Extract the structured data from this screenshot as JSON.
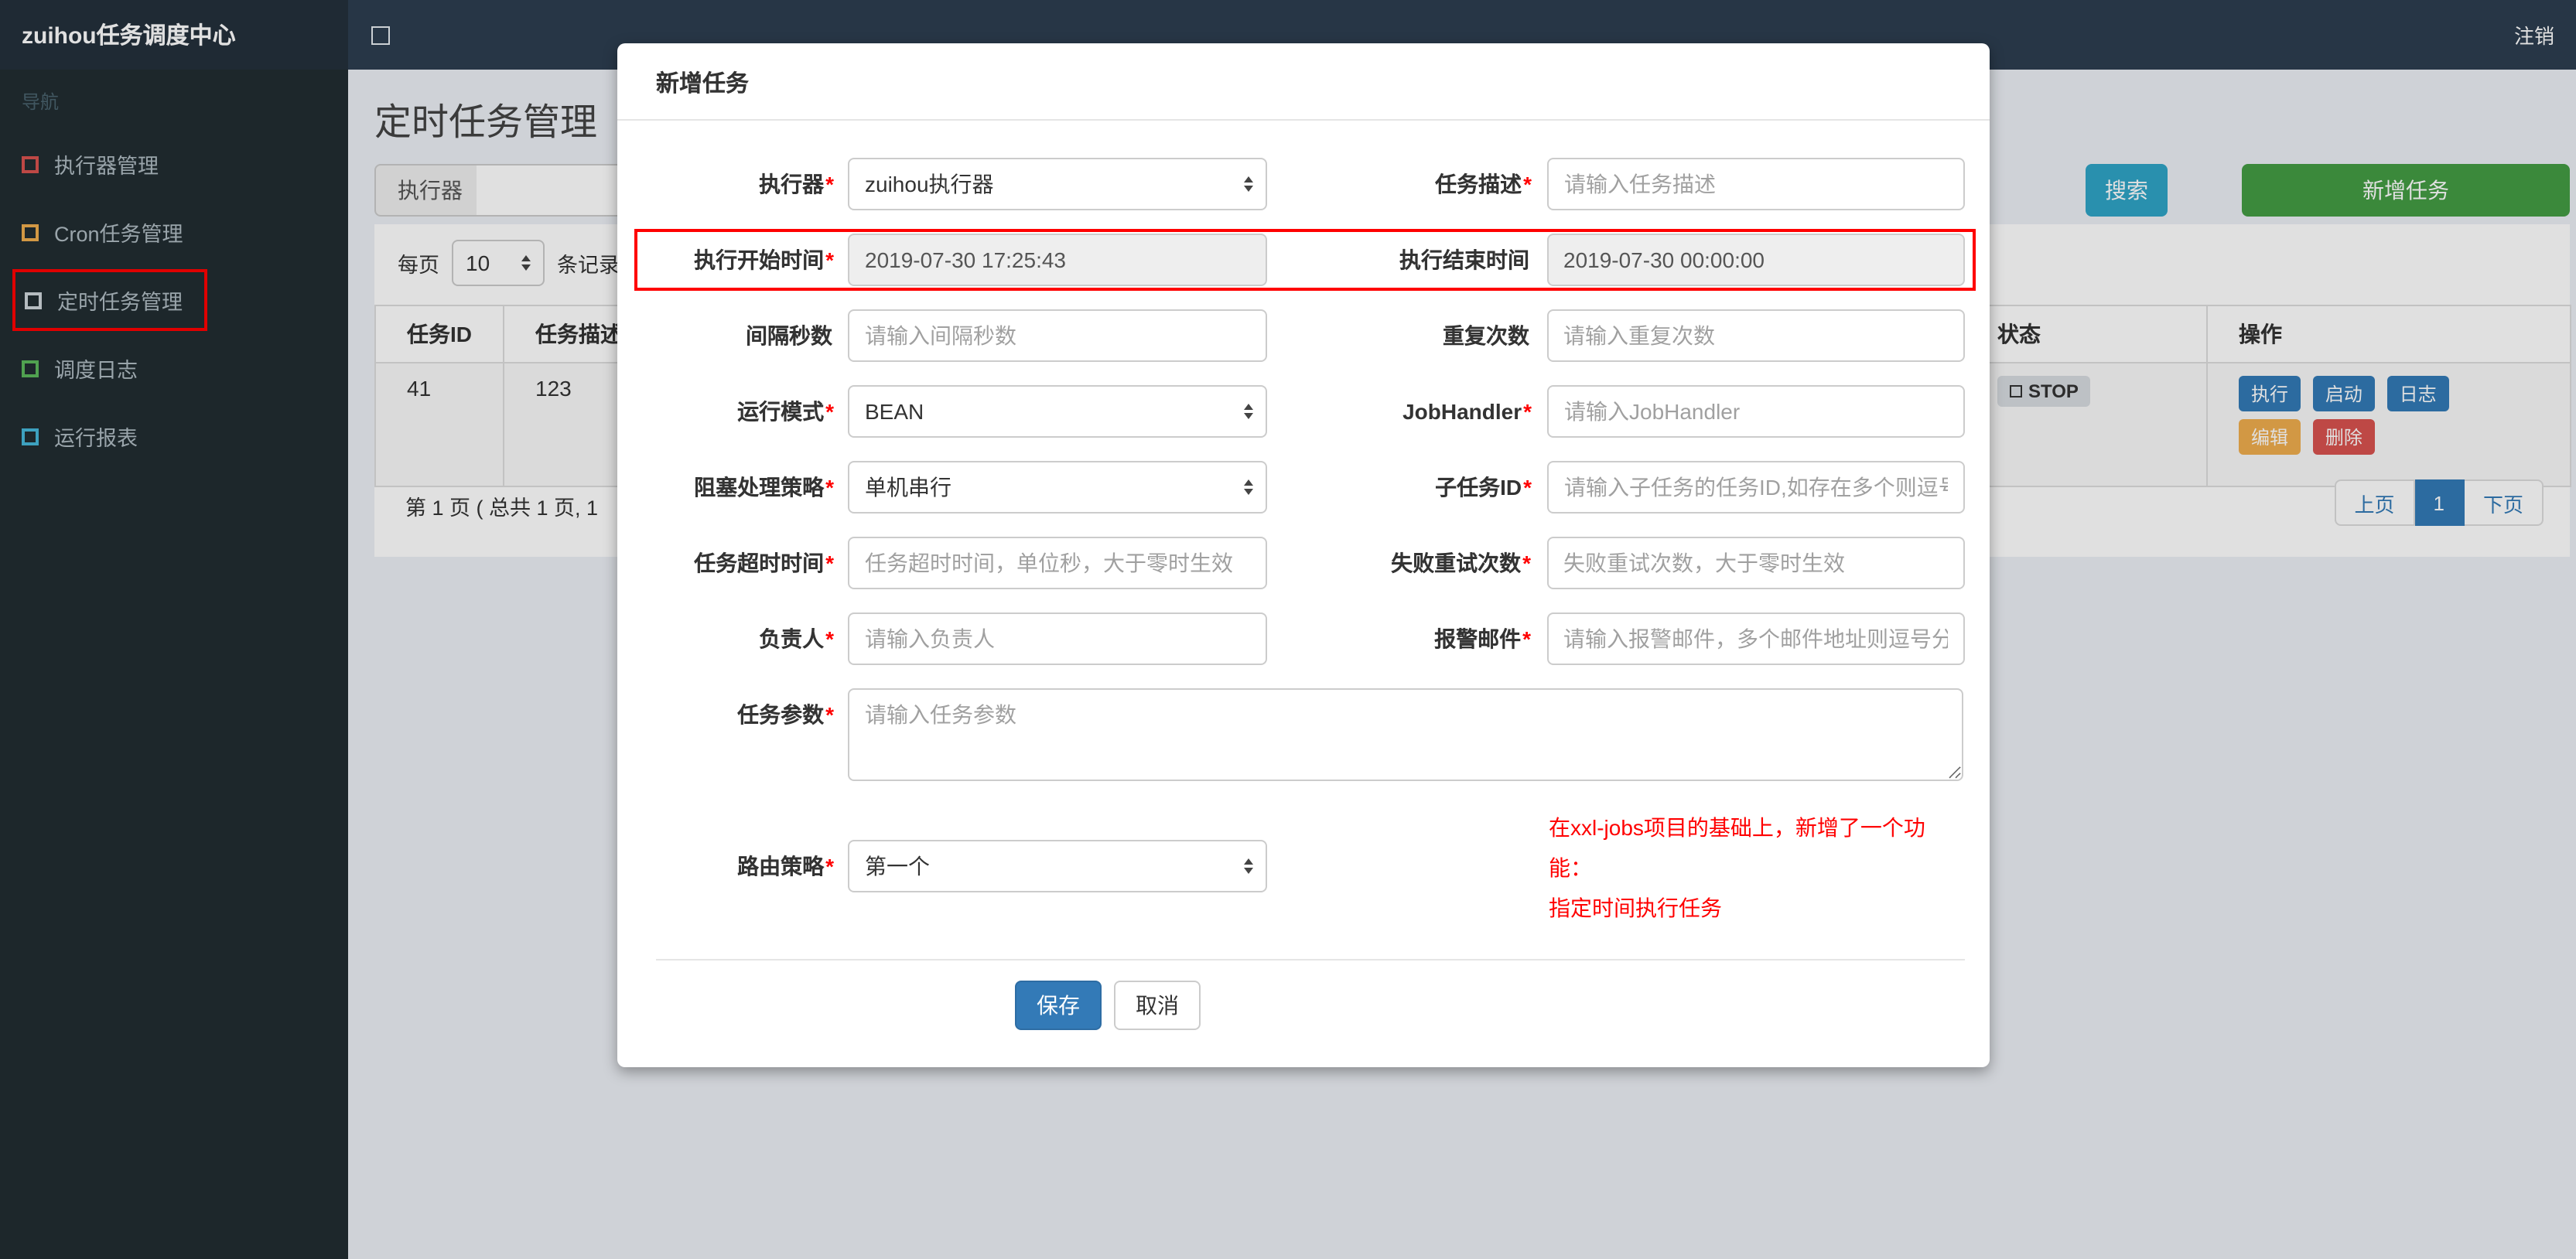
{
  "topbar": {
    "brand": "zuihou任务调度中心",
    "logout": "注销"
  },
  "sidebar": {
    "nav_header": "导航",
    "items": [
      {
        "label": "执行器管理",
        "icon_color": "#d9534f"
      },
      {
        "label": "Cron任务管理",
        "icon_color": "#f0ad4e"
      },
      {
        "label": "定时任务管理",
        "icon_color": "#cfd6db",
        "annotated": true
      },
      {
        "label": "调度日志",
        "icon_color": "#5cb85c"
      },
      {
        "label": "运行报表",
        "icon_color": "#46b8da"
      }
    ]
  },
  "page": {
    "title": "定时任务管理",
    "filter": {
      "executor_addon": "执行器",
      "search_label": "搜索",
      "add_label": "新增任务"
    },
    "page_size": {
      "prefix": "每页",
      "value": "10",
      "suffix": "条记录"
    },
    "table": {
      "headers": [
        "任务ID",
        "任务描述",
        "状态",
        "操作"
      ],
      "row": {
        "id": "41",
        "desc": "123",
        "status": "STOP",
        "actions": {
          "run": "执行",
          "start": "启动",
          "log": "日志",
          "edit": "编辑",
          "delete": "删除"
        }
      }
    },
    "pagination": {
      "summary": "第 1 页 ( 总共 1 页, 1",
      "prev": "上页",
      "current": "1",
      "next": "下页"
    }
  },
  "modal": {
    "title": "新增任务",
    "rows": [
      {
        "l_label": "执行器",
        "l_star": "*",
        "l_value": "zuihou执行器",
        "r_label": "任务描述",
        "r_star": "*",
        "r_placeholder": "请输入任务描述"
      },
      {
        "l_label": "执行开始时间",
        "l_star": "*",
        "l_value": "2019-07-30 17:25:43",
        "r_label": "执行结束时间",
        "r_star": "",
        "r_value": "2019-07-30 00:00:00"
      },
      {
        "l_label": "间隔秒数",
        "l_star": "",
        "l_placeholder": "请输入间隔秒数",
        "r_label": "重复次数",
        "r_star": "",
        "r_placeholder": "请输入重复次数"
      },
      {
        "l_label": "运行模式",
        "l_star": "*",
        "l_value": "BEAN",
        "r_label": "JobHandler",
        "r_star": "*",
        "r_placeholder": "请输入JobHandler"
      },
      {
        "l_label": "阻塞处理策略",
        "l_star": "*",
        "l_value": "单机串行",
        "r_label": "子任务ID",
        "r_star": "*",
        "r_placeholder": "请输入子任务的任务ID,如存在多个则逗号分隔"
      },
      {
        "l_label": "任务超时时间",
        "l_star": "*",
        "l_placeholder": "任务超时时间，单位秒，大于零时生效",
        "r_label": "失败重试次数",
        "r_star": "*",
        "r_placeholder": "失败重试次数，大于零时生效"
      },
      {
        "l_label": "负责人",
        "l_star": "*",
        "l_placeholder": "请输入负责人",
        "r_label": "报警邮件",
        "r_star": "*",
        "r_placeholder": "请输入报警邮件，多个邮件地址则逗号分隔"
      }
    ],
    "param_row": {
      "label": "任务参数",
      "star": "*",
      "placeholder": "请输入任务参数"
    },
    "route_row": {
      "label": "路由策略",
      "star": "*",
      "value": "第一个"
    },
    "note": {
      "line1": "在xxl-jobs项目的基础上，新增了一个功能：",
      "line2": "指定时间执行任务",
      "color": "#ff0000"
    },
    "buttons": {
      "save": "保存",
      "cancel": "取消"
    }
  },
  "colors": {
    "topbar": "#2d3e50",
    "brand_bg": "#24303c",
    "sidebar": "#222d32",
    "search_button": "#2fa4c7",
    "add_button": "#449d44",
    "primary": "#337ab7",
    "warning": "#f0ad4e",
    "danger": "#d9534f",
    "annotation": "#ff0000",
    "readonly_bg": "#eeeeee"
  }
}
